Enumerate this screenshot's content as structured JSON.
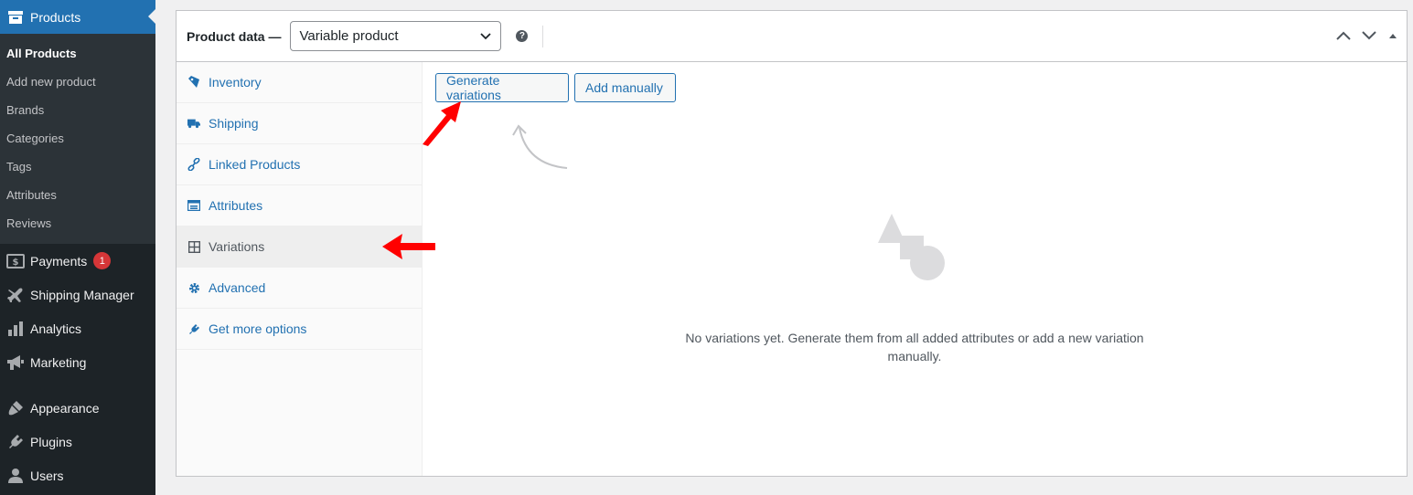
{
  "sidebar": {
    "current": {
      "label": "Products",
      "icon": "archive-icon"
    },
    "submenu": [
      {
        "label": "All Products",
        "active": true
      },
      {
        "label": "Add new product"
      },
      {
        "label": "Brands"
      },
      {
        "label": "Categories"
      },
      {
        "label": "Tags"
      },
      {
        "label": "Attributes"
      },
      {
        "label": "Reviews"
      }
    ],
    "items": [
      {
        "label": "Payments",
        "icon": "payments-icon",
        "badge": "1"
      },
      {
        "label": "Shipping Manager",
        "icon": "plane-icon"
      },
      {
        "label": "Analytics",
        "icon": "bar-chart-icon"
      },
      {
        "label": "Marketing",
        "icon": "megaphone-icon"
      },
      {
        "label": "Appearance",
        "icon": "paintbrush-icon"
      },
      {
        "label": "Plugins",
        "icon": "plug-icon"
      },
      {
        "label": "Users",
        "icon": "user-icon"
      }
    ]
  },
  "product_data": {
    "title": "Product data —",
    "type_select": "Variable product",
    "help": "?"
  },
  "tabs": [
    {
      "label": "Inventory",
      "icon": "tag-icon"
    },
    {
      "label": "Shipping",
      "icon": "truck-icon"
    },
    {
      "label": "Linked Products",
      "icon": "link-icon"
    },
    {
      "label": "Attributes",
      "icon": "attributes-icon"
    },
    {
      "label": "Variations",
      "icon": "grid-icon",
      "active": true
    },
    {
      "label": "Advanced",
      "icon": "gear-icon"
    },
    {
      "label": "Get more options",
      "icon": "plugin-icon"
    }
  ],
  "variations": {
    "generate_label": "Generate variations",
    "add_manually_label": "Add manually",
    "empty_message": "No variations yet. Generate them from all added attributes or add a new variation manually."
  },
  "colors": {
    "sidebar_bg": "#1d2327",
    "accent": "#2271b1",
    "annotation_arrow": "#ff0000"
  }
}
